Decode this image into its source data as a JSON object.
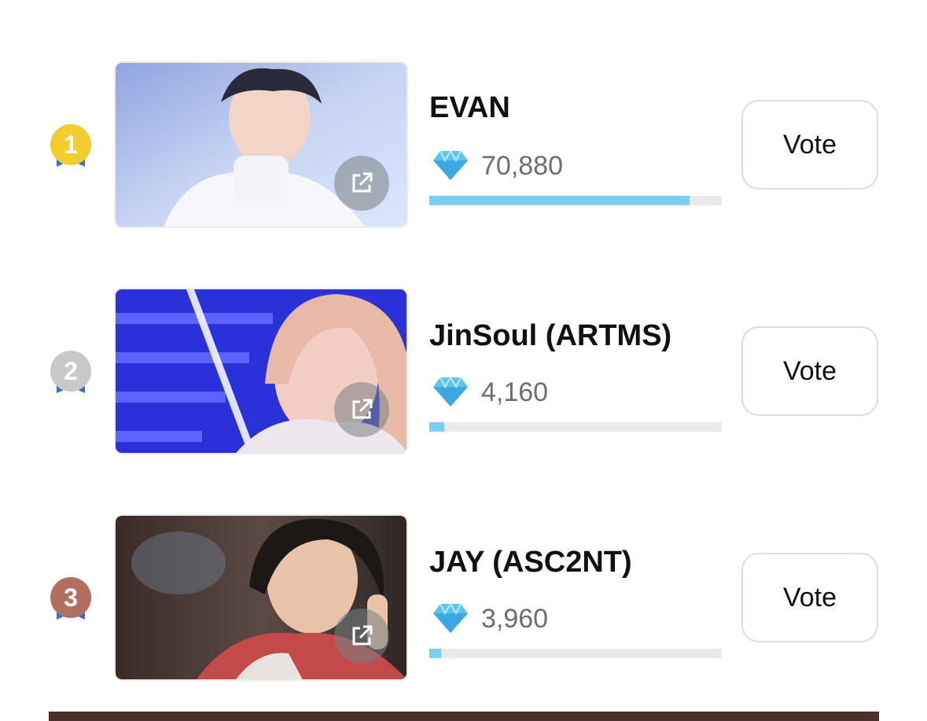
{
  "colors": {
    "bar_fill": "#7ccdf0",
    "bar_track": "#eaeaea",
    "gold": "#f3cd2d",
    "silver": "#c8c8c8",
    "bronze": "#b36e5f",
    "ribbon": "#2f6fd6"
  },
  "icons": {
    "vote_currency": "diamond-icon",
    "open_link": "external-link-icon"
  },
  "ranking": [
    {
      "rank": "1",
      "name": "EVAN",
      "votes": "70,880",
      "progress": 0.89,
      "vote_label": "Vote"
    },
    {
      "rank": "2",
      "name": "JinSoul (ARTMS)",
      "votes": "4,160",
      "progress": 0.05,
      "vote_label": "Vote"
    },
    {
      "rank": "3",
      "name": "JAY (ASC2NT)",
      "votes": "3,960",
      "progress": 0.04,
      "vote_label": "Vote"
    }
  ]
}
